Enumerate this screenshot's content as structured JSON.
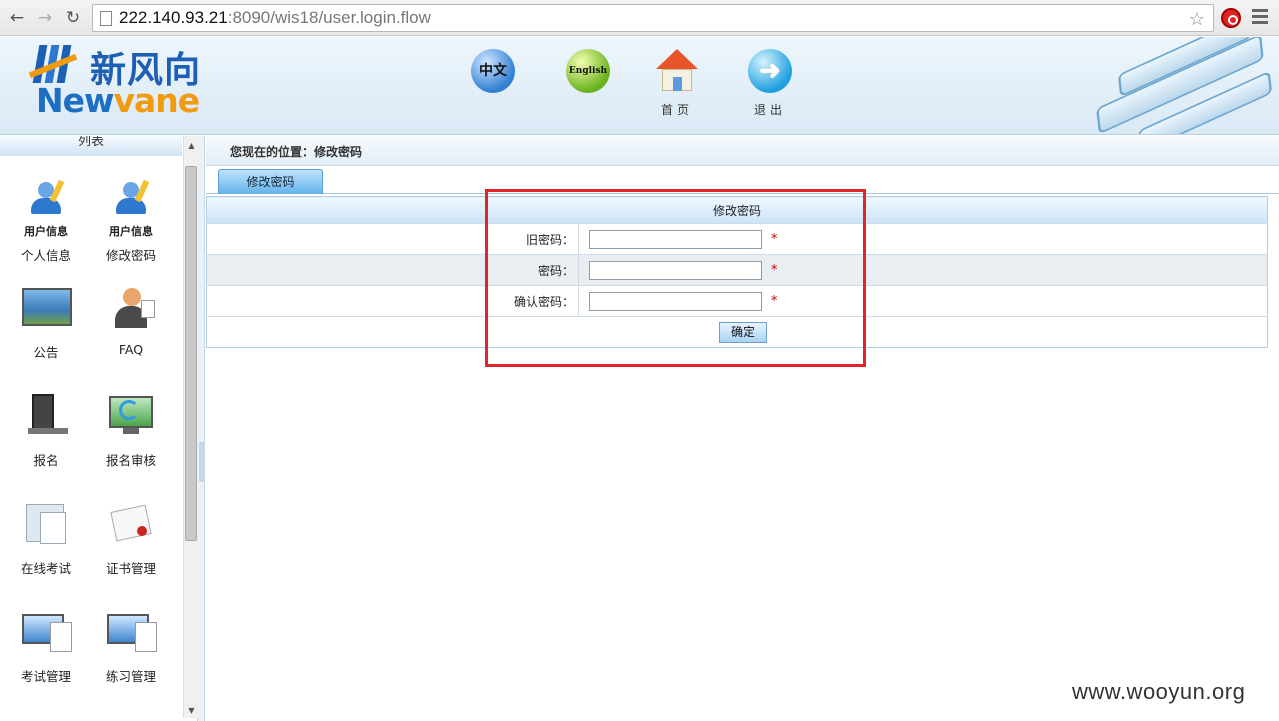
{
  "browser": {
    "url_host": "222.140.93.21",
    "url_rest": ":8090/wis18/user.login.flow"
  },
  "header": {
    "logo_cn": "新风向",
    "logo_en_a": "New",
    "logo_en_b": "vane",
    "lang_cn_label": "中文",
    "lang_en_label": "English",
    "home_label": "首页",
    "logout_label": "退出"
  },
  "sidebar": {
    "title": "列表",
    "items": [
      {
        "label": "个人信息",
        "sub": "用户信息",
        "icon": "user-info-icon"
      },
      {
        "label": "修改密码",
        "sub": "用户信息",
        "icon": "user-info-icon"
      },
      {
        "label": "公告",
        "icon": "monitor-icon"
      },
      {
        "label": "FAQ",
        "icon": "person-icon"
      },
      {
        "label": "报名",
        "icon": "computer-tower-icon"
      },
      {
        "label": "报名审核",
        "icon": "monitor-refresh-icon"
      },
      {
        "label": "在线考试",
        "icon": "folder-document-icon"
      },
      {
        "label": "证书管理",
        "icon": "certificate-icon"
      },
      {
        "label": "考试管理",
        "icon": "computer-document-icon"
      },
      {
        "label": "练习管理",
        "icon": "computer-document-icon"
      }
    ]
  },
  "main": {
    "breadcrumb": "您现在的位置：修改密码",
    "tab_label": "修改密码",
    "form": {
      "title": "修改密码",
      "old_password_label": "旧密码：",
      "new_password_label": "密码：",
      "confirm_password_label": "确认密码：",
      "required_mark": "*",
      "submit_label": "确定"
    }
  },
  "watermark": "www.wooyun.org",
  "colors": {
    "highlight_border": "#e0242a",
    "brand_blue": "#1d5fb4",
    "brand_orange": "#f29a12"
  }
}
